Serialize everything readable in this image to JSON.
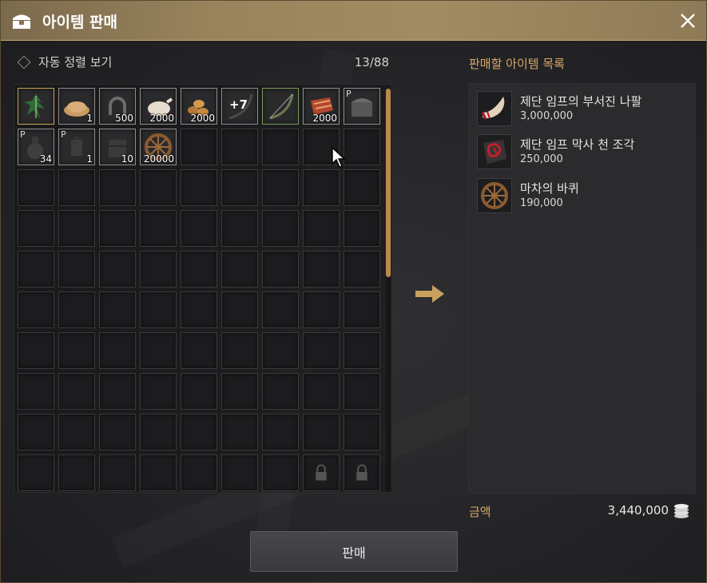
{
  "window": {
    "title": "아이템 판매",
    "title_icon": "chest-icon",
    "close_icon": "close-icon"
  },
  "inventory": {
    "sort_label": "자동 정렬 보기",
    "count": "13/88",
    "slots": [
      {
        "icon": "leaf-herb-icon"
      },
      {
        "icon": "sand-pile-icon",
        "qty": "1"
      },
      {
        "icon": "horseshoe-icon",
        "qty": "500"
      },
      {
        "icon": "chicken-meat-icon",
        "qty": "2000"
      },
      {
        "icon": "nuts-icon",
        "qty": "2000"
      },
      {
        "icon": "enhanced-bow-icon",
        "enhance": "+7"
      },
      {
        "icon": "bow-icon"
      },
      {
        "icon": "fish-meat-icon",
        "qty": "2000"
      },
      {
        "icon": "storage-chest-icon",
        "p": "P"
      },
      {
        "icon": "bottle-icon",
        "p": "P",
        "qty": "34"
      },
      {
        "icon": "lantern-icon",
        "p": "P",
        "qty": "1"
      },
      {
        "icon": "box-icon",
        "qty": "10"
      },
      {
        "icon": "wagon-wheel-icon",
        "qty": "20000"
      }
    ]
  },
  "sell_list": {
    "title": "판매할 아이템 목록",
    "items": [
      {
        "icon": "horn-icon",
        "name": "제단 임프의 부서진 나팔",
        "price": "3,000,000"
      },
      {
        "icon": "cloth-icon",
        "name": "제단 임프 막사 천 조각",
        "price": "250,000"
      },
      {
        "icon": "wagon-wheel-icon",
        "name": "마차의 바퀴",
        "price": "190,000"
      }
    ]
  },
  "total": {
    "label": "금액",
    "value": "3,440,000",
    "icon": "silver-coins-icon"
  },
  "sell_button": {
    "label": "판매"
  },
  "colors": {
    "accent": "#d6a86a",
    "titlebar": "#98835c",
    "scroll": "#b98a4d"
  }
}
